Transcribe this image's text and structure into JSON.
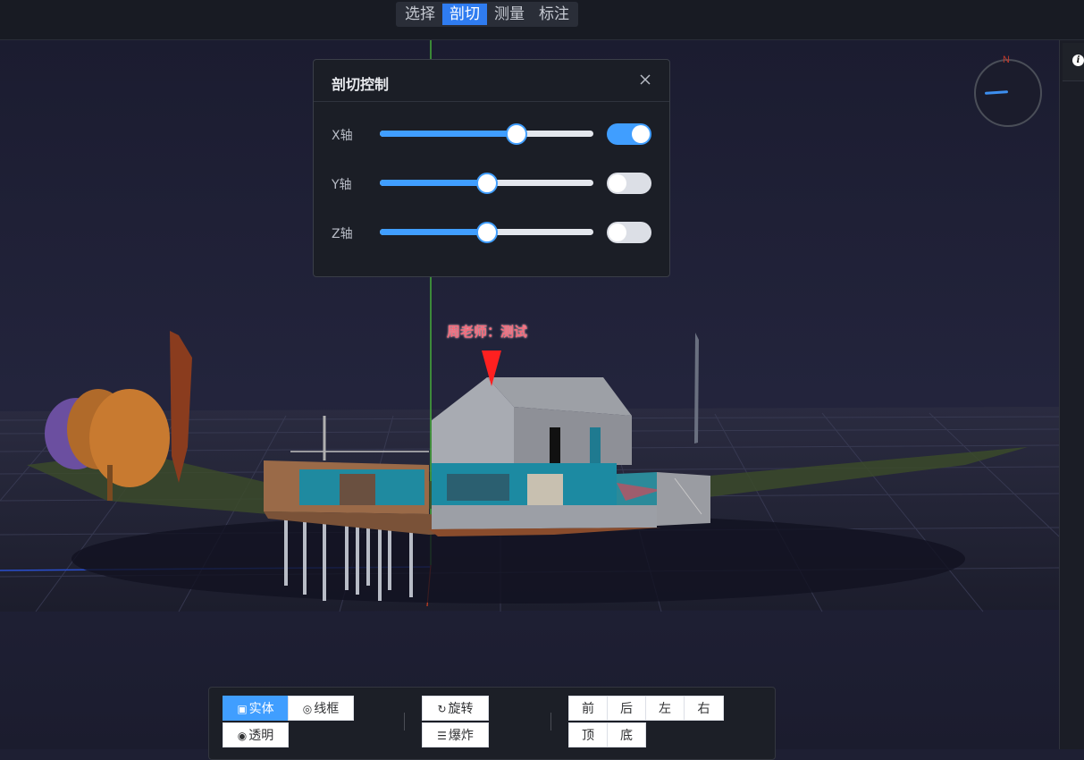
{
  "toolbar_top": {
    "tabs": [
      {
        "label": "选择",
        "active": false
      },
      {
        "label": "剖切",
        "active": true
      },
      {
        "label": "测量",
        "active": false
      },
      {
        "label": "标注",
        "active": false
      }
    ]
  },
  "compass": {
    "north_label": "N"
  },
  "section_panel": {
    "title": "剖切控制",
    "axes": [
      {
        "label": "X轴",
        "slider_fraction": 0.64,
        "enabled": true
      },
      {
        "label": "Y轴",
        "slider_fraction": 0.5,
        "enabled": false
      },
      {
        "label": "Z轴",
        "slider_fraction": 0.5,
        "enabled": false
      }
    ]
  },
  "scene": {
    "annotation_text": "周老师：测试",
    "marker_color": "#ff2020"
  },
  "bottom_toolbar": {
    "render_modes": {
      "solid": "实体",
      "wireframe": "线框",
      "transparent": "透明"
    },
    "actions": {
      "rotate": "旋转",
      "explode": "爆炸"
    },
    "views": {
      "front": "前",
      "back": "后",
      "left": "左",
      "right": "右",
      "top": "顶",
      "bottom": "底"
    }
  },
  "colors": {
    "accent": "#409eff",
    "active_tab": "#2f7cf0",
    "background": "#1e1f33"
  }
}
